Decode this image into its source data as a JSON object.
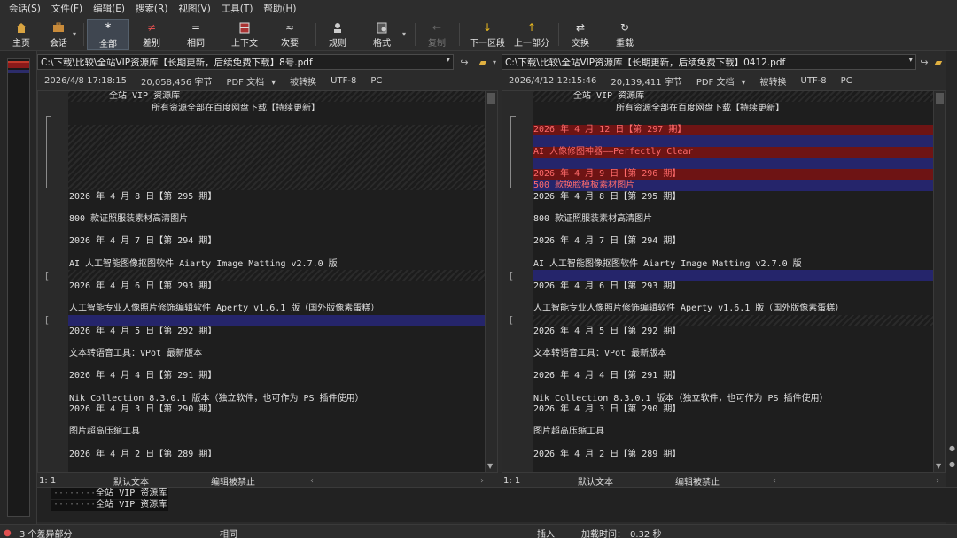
{
  "menu": [
    "会话(S)",
    "文件(F)",
    "编辑(E)",
    "搜索(R)",
    "视图(V)",
    "工具(T)",
    "帮助(H)"
  ],
  "toolbar": {
    "home": "主页",
    "session": "会话",
    "all": "全部",
    "diff": "差别",
    "same": "相同",
    "context": "上下文",
    "minor": "次要",
    "rules": "规则",
    "format": "格式",
    "copy": "复制",
    "next_section": "下一区段",
    "prev_part": "上一部分",
    "swap": "交换",
    "reload": "重载"
  },
  "left": {
    "path": "C:\\下载\\比较\\全站VIP资源库【长期更新，后续免费下载】8号.pdf",
    "date": "2026/4/8 17:18:15",
    "size": "20,058,456 字节",
    "format": "PDF 文档",
    "convert": "被转换",
    "encoding": "UTF-8",
    "eol": "PC",
    "status_pos": "1: 1",
    "status_text": "默认文本",
    "status_edit": "编辑被禁止",
    "lines": {
      "title": "全站 VIP 资源库",
      "subtitle": "所有资源全部在百度网盘下载【持续更新】",
      "l1": "2026 年 4 月 8 日【第 295 期】",
      "l2": "800 款证照服装素材高清图片",
      "l3": "2026 年 4 月 7 日【第 294 期】",
      "l4": "AI 人工智能图像抠图软件 Aiarty Image Matting v2.7.0 版",
      "l5": "2026 年 4 月 6 日【第 293 期】",
      "l6": "人工智能专业人像照片修饰编辑软件 Aperty v1.6.1 版（国外版像素蛋糕）",
      "l7": "2026 年 4 月 5 日【第 292 期】",
      "l8": "文本转语音工具：VPot 最新版本",
      "l9": "2026 年 4 月 4 日【第 291 期】",
      "l10": "Nik Collection 8.3.0.1 版本（独立软件，也可作为 PS 插件使用）",
      "l11": "2026 年 4 月 3 日【第 290 期】",
      "l12": "图片超高压缩工具",
      "l13": "2026 年 4 月 2 日【第 289 期】"
    }
  },
  "right": {
    "path": "C:\\下载\\比较\\全站VIP资源库【长期更新，后续免费下载】0412.pdf",
    "date": "2026/4/12 12:15:46",
    "size": "20,139,411 字节",
    "format": "PDF 文档",
    "convert": "被转换",
    "encoding": "UTF-8",
    "eol": "PC",
    "status_pos": "1: 1",
    "status_text": "默认文本",
    "status_edit": "编辑被禁止",
    "lines": {
      "title": "全站 VIP 资源库",
      "subtitle": "所有资源全部在百度网盘下载【持续更新】",
      "r1": "2026 年 4 月 12 日【第 297 期】",
      "r2": "AI 人像修图神器——Perfectly Clear",
      "r3": "2026 年 4 月 9 日【第 296 期】",
      "r4": "500 款换脸模板素材图片",
      "l1": "2026 年 4 月 8 日【第 295 期】",
      "l2": "800 款证照服装素材高清图片",
      "l3": "2026 年 4 月 7 日【第 294 期】",
      "l4": "AI 人工智能图像抠图软件 Aiarty Image Matting v2.7.0 版",
      "l5": "2026 年 4 月 6 日【第 293 期】",
      "l6": "人工智能专业人像照片修饰编辑软件 Aperty v1.6.1 版（国外版像素蛋糕）",
      "l7": "2026 年 4 月 5 日【第 292 期】",
      "l8": "文本转语音工具：VPot 最新版本",
      "l9": "2026 年 4 月 4 日【第 291 期】",
      "l10": "Nik Collection 8.3.0.1 版本（独立软件，也可作为 PS 插件使用）",
      "l11": "2026 年 4 月 3 日【第 290 期】",
      "l12": "图片超高压缩工具",
      "l13": "2026 年 4 月 2 日【第 289 期】"
    }
  },
  "detail": {
    "line1": "全站 VIP 资源库",
    "line2": "全站 VIP 资源库"
  },
  "statusbar": {
    "diffs": "3 个差异部分",
    "same": "相同",
    "mode": "插入",
    "load_label": "加载时间：",
    "load_time": "0.32 秒"
  },
  "colors": {
    "diff_red": "#6e1414",
    "diff_blue": "#25256b",
    "red_text": "#ff6b6b"
  }
}
